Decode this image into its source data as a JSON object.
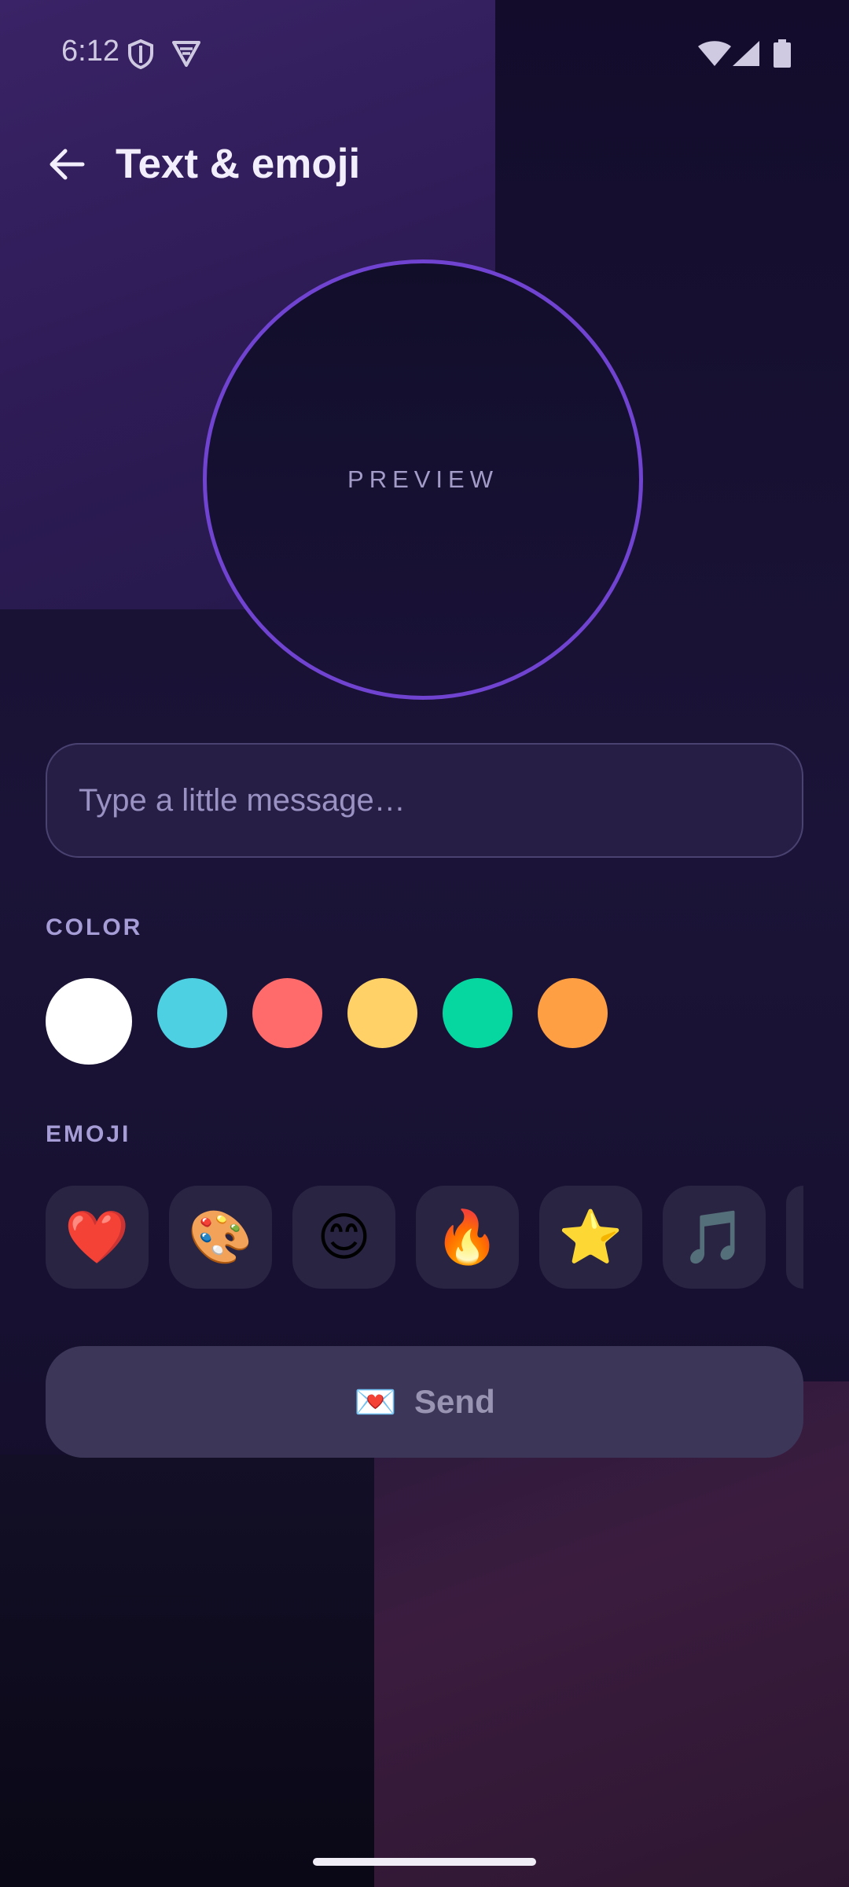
{
  "status_bar": {
    "time": "6:12",
    "icons": [
      "shield-icon",
      "vpn-icon",
      "wifi-icon",
      "cellular-signal-icon",
      "battery-icon"
    ]
  },
  "app_bar": {
    "back_icon": "arrow-back-icon",
    "title": "Text & emoji"
  },
  "preview": {
    "label": "PREVIEW",
    "ring_color": "#7043d0"
  },
  "message_input": {
    "placeholder": "Type a little message…",
    "value": ""
  },
  "color_section": {
    "label": "COLOR",
    "swatches": [
      {
        "name": "white",
        "hex": "#ffffff",
        "selected": true
      },
      {
        "name": "cyan",
        "hex": "#4dd0e1",
        "selected": false
      },
      {
        "name": "coral",
        "hex": "#ff6b6b",
        "selected": false
      },
      {
        "name": "yellow",
        "hex": "#ffd166",
        "selected": false
      },
      {
        "name": "green",
        "hex": "#06d6a0",
        "selected": false
      },
      {
        "name": "orange",
        "hex": "#ff9f43",
        "selected": false
      }
    ]
  },
  "emoji_section": {
    "label": "EMOJI",
    "items": [
      "❤️",
      "🎨",
      "😊",
      "🔥",
      "⭐",
      "🎵",
      ""
    ]
  },
  "send_button": {
    "emoji": "💌",
    "label": "Send",
    "enabled": false
  },
  "colors": {
    "background": "#1a1233",
    "accent": "#7043d0",
    "surface": "#261e45"
  }
}
